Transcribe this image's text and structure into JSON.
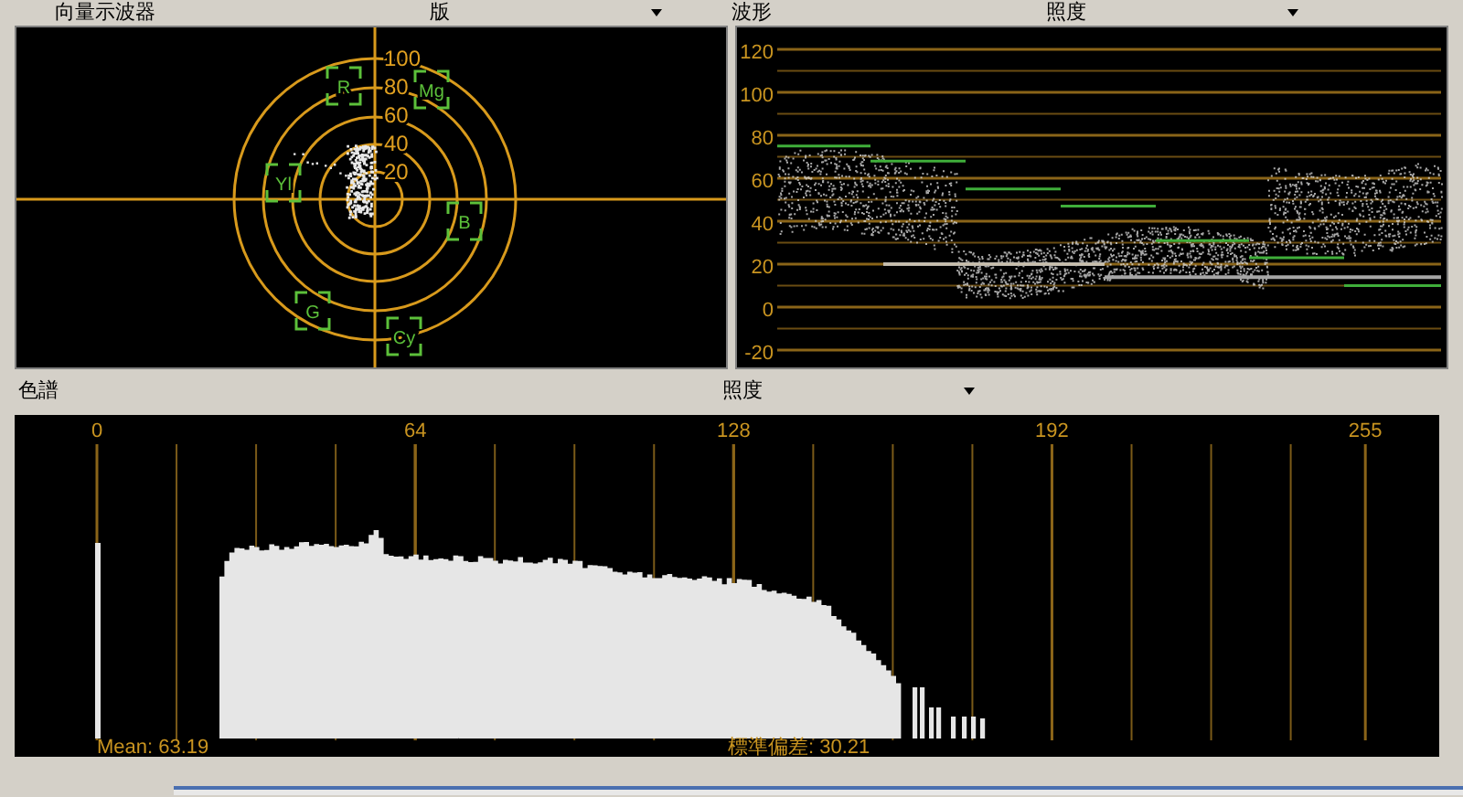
{
  "vectorscope": {
    "title": "向量示波器",
    "mode": "版",
    "scale_labels": [
      "100",
      "80",
      "60",
      "40",
      "20"
    ],
    "targets": [
      "R",
      "Mg",
      "Yl",
      "B",
      "G",
      "Cy"
    ]
  },
  "waveform": {
    "title": "波形",
    "mode": "照度",
    "scale_labels": [
      "120",
      "100",
      "80",
      "60",
      "40",
      "20",
      "0",
      "-20"
    ]
  },
  "histogram": {
    "title": "色譜",
    "mode": "照度",
    "ticks": [
      "0",
      "64",
      "128",
      "192",
      "255"
    ],
    "mean": "Mean: 63.19",
    "std_dev": "標準偏差: 30.21"
  }
}
